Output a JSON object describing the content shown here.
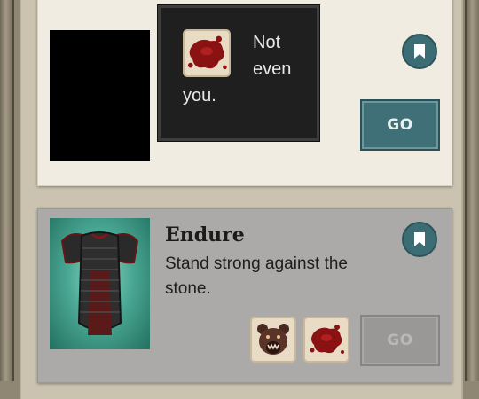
{
  "cards": [
    {
      "go_label": "GO",
      "state": "active"
    },
    {
      "title": "Endure",
      "description": "Stand strong against the stone.",
      "go_label": "GO",
      "state": "disabled",
      "skills": [
        {
          "icon": "bear-icon"
        },
        {
          "icon": "blood-splatter-icon"
        }
      ]
    }
  ],
  "tooltip": {
    "icon": "blood-splatter-icon",
    "line1": "Not",
    "line2": "even",
    "line3": "you."
  },
  "colors": {
    "accent": "#3f7078",
    "card_light": "#f1ece1",
    "card_disabled": "#acaaa8",
    "tooltip_bg": "#1f1f1f"
  }
}
